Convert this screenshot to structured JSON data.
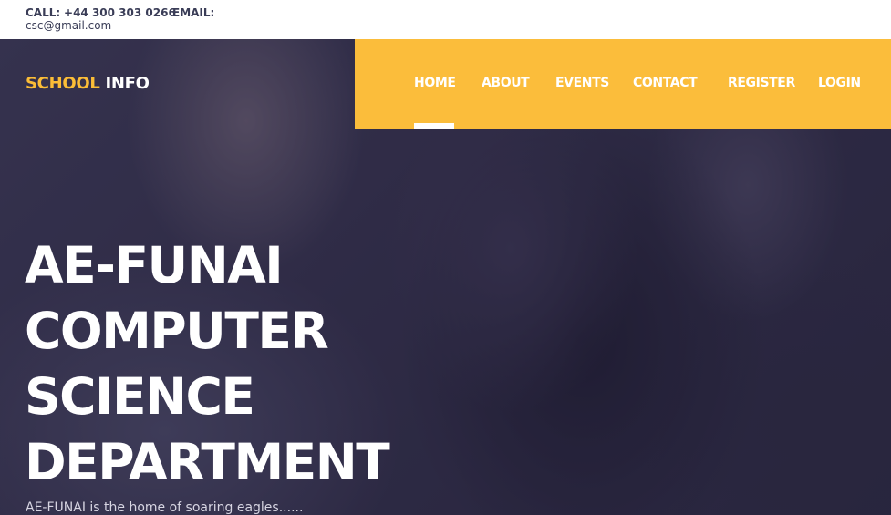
{
  "topbar": {
    "call_label": "CALL:",
    "call_value": "+44 300 303 0266",
    "email_label": "EMAIL:",
    "email_value": "csc@gmail.com"
  },
  "logo": {
    "part1": "SCHOOL",
    "part2": "INFO"
  },
  "nav": {
    "items": [
      {
        "label": "HOME",
        "active": true
      },
      {
        "label": "ABOUT"
      },
      {
        "label": "EVENTS"
      },
      {
        "label": "CONTACT"
      },
      {
        "label": "REGISTER"
      },
      {
        "label": "LOGIN"
      }
    ]
  },
  "hero": {
    "title_lines": [
      "AE-FUNAI",
      "COMPUTER",
      "SCIENCE",
      "DEPARTMENT"
    ],
    "tagline": "AE-FUNAI is the home of soaring eagles......"
  },
  "colors": {
    "accent": "#fbbd3b",
    "text_light": "#ffffff",
    "topbar_text": "#3a3d57"
  }
}
